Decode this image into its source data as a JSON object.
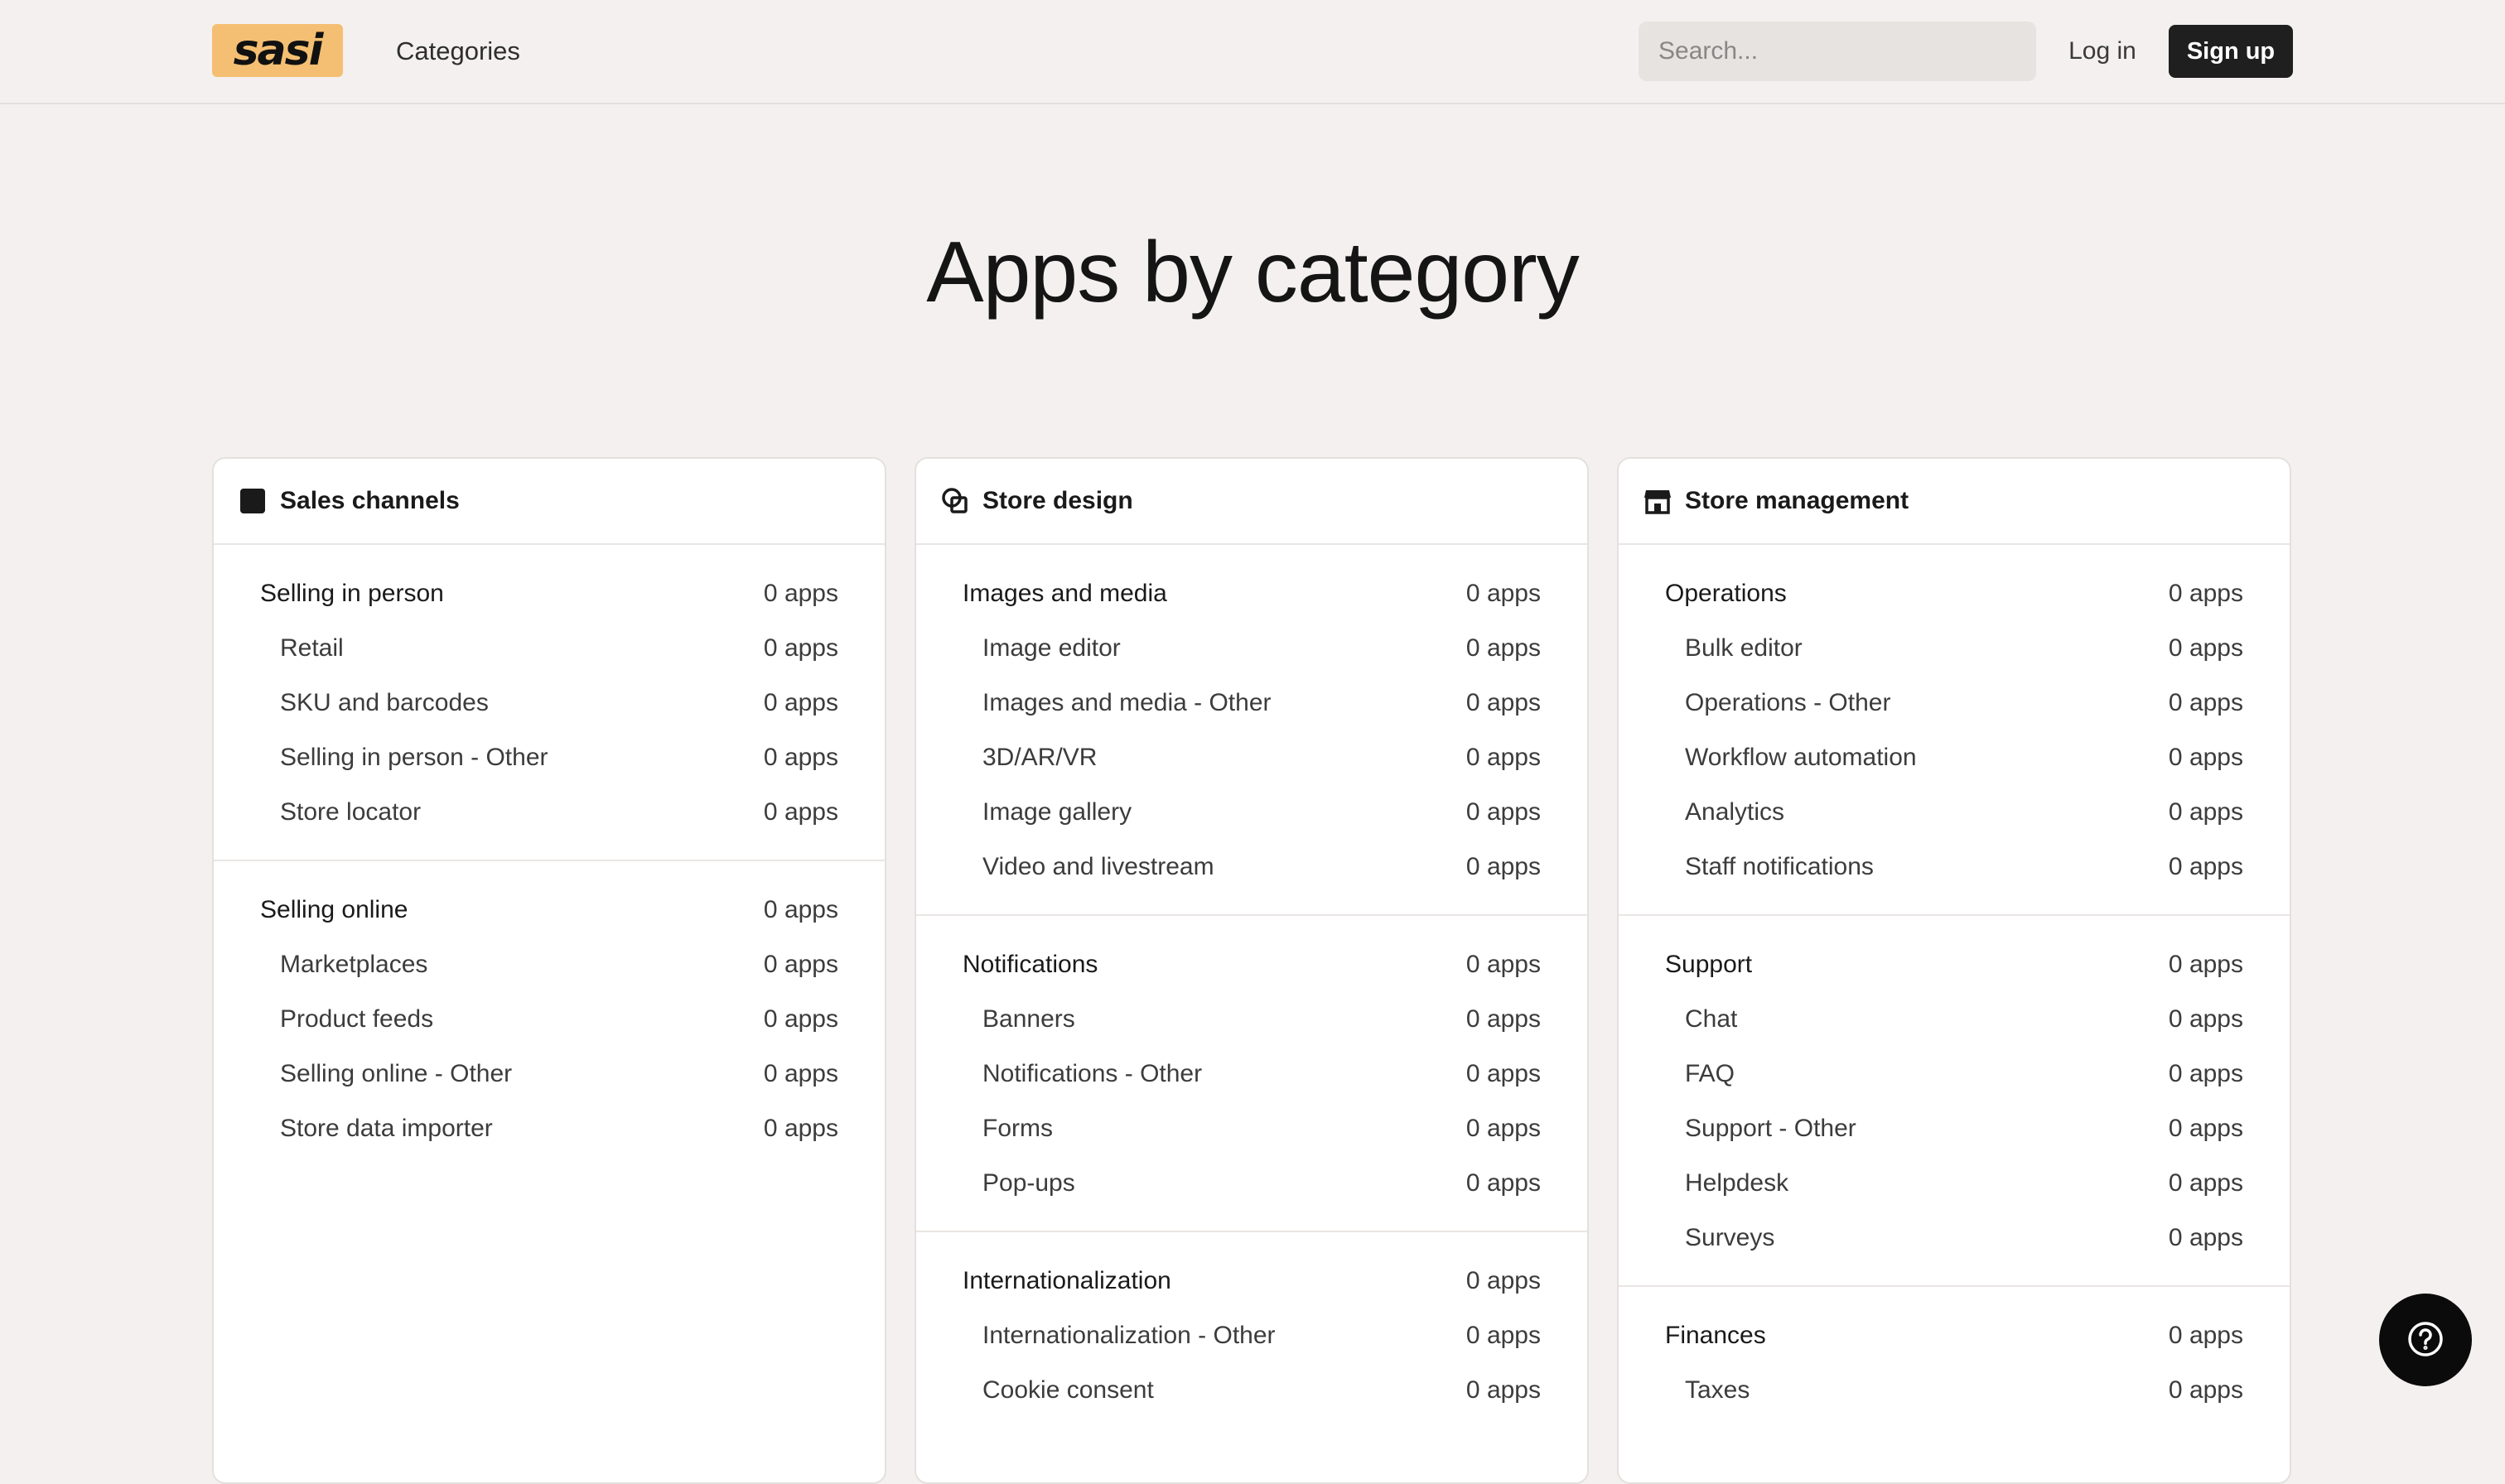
{
  "header": {
    "logo_text": "sasi",
    "nav_categories": "Categories",
    "search_placeholder": "Search...",
    "login_label": "Log in",
    "signup_label": "Sign up"
  },
  "page_title": "Apps by category",
  "colors": {
    "logo_bg": "#f4bf72",
    "signup_bg": "#1f1f1f",
    "page_bg": "#f3f0ef"
  },
  "cards": [
    {
      "title": "Sales channels",
      "icon": "square-icon",
      "groups": [
        {
          "name": "Selling in person",
          "count": "0 apps",
          "items": [
            {
              "name": "Retail",
              "count": "0 apps"
            },
            {
              "name": "SKU and barcodes",
              "count": "0 apps"
            },
            {
              "name": "Selling in person - Other",
              "count": "0 apps"
            },
            {
              "name": "Store locator",
              "count": "0 apps"
            }
          ]
        },
        {
          "name": "Selling online",
          "count": "0 apps",
          "items": [
            {
              "name": "Marketplaces",
              "count": "0 apps"
            },
            {
              "name": "Product feeds",
              "count": "0 apps"
            },
            {
              "name": "Selling online - Other",
              "count": "0 apps"
            },
            {
              "name": "Store data importer",
              "count": "0 apps"
            }
          ]
        }
      ]
    },
    {
      "title": "Store design",
      "icon": "design-shapes-icon",
      "groups": [
        {
          "name": "Images and media",
          "count": "0 apps",
          "items": [
            {
              "name": "Image editor",
              "count": "0 apps"
            },
            {
              "name": "Images and media - Other",
              "count": "0 apps"
            },
            {
              "name": "3D/AR/VR",
              "count": "0 apps"
            },
            {
              "name": "Image gallery",
              "count": "0 apps"
            },
            {
              "name": "Video and livestream",
              "count": "0 apps"
            }
          ]
        },
        {
          "name": "Notifications",
          "count": "0 apps",
          "items": [
            {
              "name": "Banners",
              "count": "0 apps"
            },
            {
              "name": "Notifications - Other",
              "count": "0 apps"
            },
            {
              "name": "Forms",
              "count": "0 apps"
            },
            {
              "name": "Pop-ups",
              "count": "0 apps"
            }
          ]
        },
        {
          "name": "Internationalization",
          "count": "0 apps",
          "items": [
            {
              "name": "Internationalization - Other",
              "count": "0 apps"
            },
            {
              "name": "Cookie consent",
              "count": "0 apps"
            }
          ]
        }
      ]
    },
    {
      "title": "Store management",
      "icon": "store-icon",
      "groups": [
        {
          "name": "Operations",
          "count": "0 apps",
          "items": [
            {
              "name": "Bulk editor",
              "count": "0 apps"
            },
            {
              "name": "Operations - Other",
              "count": "0 apps"
            },
            {
              "name": "Workflow automation",
              "count": "0 apps"
            },
            {
              "name": "Analytics",
              "count": "0 apps"
            },
            {
              "name": "Staff notifications",
              "count": "0 apps"
            }
          ]
        },
        {
          "name": "Support",
          "count": "0 apps",
          "items": [
            {
              "name": "Chat",
              "count": "0 apps"
            },
            {
              "name": "FAQ",
              "count": "0 apps"
            },
            {
              "name": "Support - Other",
              "count": "0 apps"
            },
            {
              "name": "Helpdesk",
              "count": "0 apps"
            },
            {
              "name": "Surveys",
              "count": "0 apps"
            }
          ]
        },
        {
          "name": "Finances",
          "count": "0 apps",
          "items": [
            {
              "name": "Taxes",
              "count": "0 apps"
            }
          ]
        }
      ]
    }
  ],
  "help_button_icon": "help-circle-icon"
}
